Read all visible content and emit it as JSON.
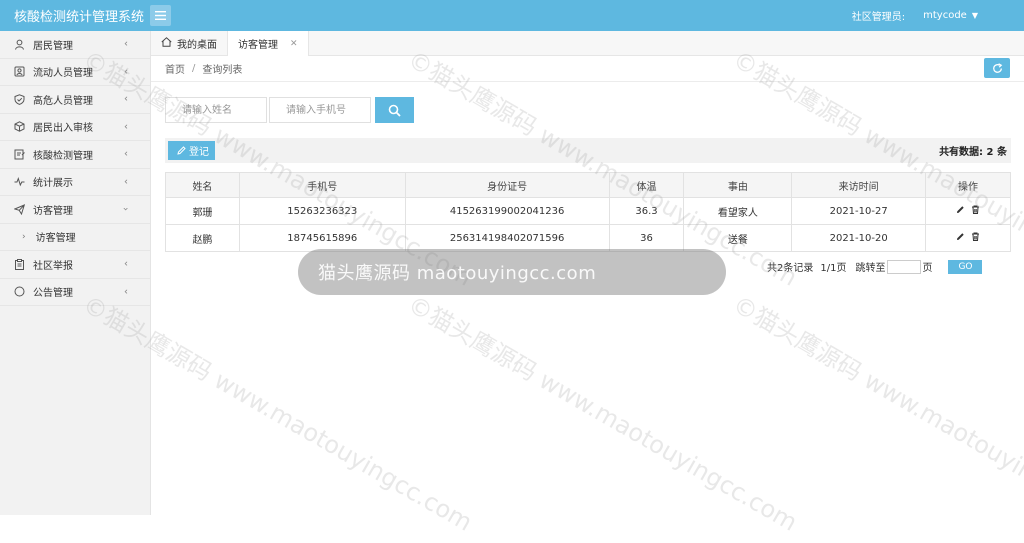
{
  "header": {
    "app_title": "核酸检测统计管理系统",
    "role_label": "社区管理员:",
    "username": "mtycode"
  },
  "sidebar": {
    "items": [
      {
        "label": "居民管理",
        "icon": "person-icon"
      },
      {
        "label": "流动人员管理",
        "icon": "user-group-icon"
      },
      {
        "label": "高危人员管理",
        "icon": "shield-icon"
      },
      {
        "label": "居民出入审核",
        "icon": "cube-icon"
      },
      {
        "label": "核酸检测管理",
        "icon": "edit-document-icon"
      },
      {
        "label": "统计展示",
        "icon": "pulse-icon"
      },
      {
        "label": "访客管理",
        "icon": "send-icon",
        "expanded": true
      }
    ],
    "sub_item": "访客管理",
    "items_after": [
      {
        "label": "社区举报",
        "icon": "clipboard-icon"
      },
      {
        "label": "公告管理",
        "icon": "circle-icon"
      }
    ]
  },
  "tabs": [
    {
      "label": "我的桌面",
      "active": false
    },
    {
      "label": "访客管理",
      "active": true
    }
  ],
  "breadcrumb": [
    "首页",
    "查询列表"
  ],
  "search": {
    "name_placeholder": "请输入姓名",
    "phone_placeholder": "请输入手机号"
  },
  "toolbar": {
    "add_label": "登记",
    "total_label": "共有数据:",
    "total_count": "2 条"
  },
  "table": {
    "columns": [
      "姓名",
      "手机号",
      "身份证号",
      "体温",
      "事由",
      "来访时间",
      "操作"
    ],
    "rows": [
      [
        "郭珊",
        "15263236323",
        "415263199002041236",
        "36.3",
        "看望家人",
        "2021-10-27"
      ],
      [
        "赵鹏",
        "18745615896",
        "256314198402071596",
        "36",
        "送餐",
        "2021-10-20"
      ]
    ]
  },
  "pager": {
    "records": "共2条记录",
    "pages": "1/1页",
    "jump_label": "跳转至",
    "page_unit": "页",
    "go_label": "GO"
  },
  "banner": {
    "text": "猫头鹰源码 maotouyingcc.com"
  },
  "watermark": {
    "text": "©猫头鹰源码 www.maotouyingcc.com"
  },
  "colors": {
    "accent": "#5eb8e0",
    "sidebar_bg": "#f2f2f2"
  }
}
